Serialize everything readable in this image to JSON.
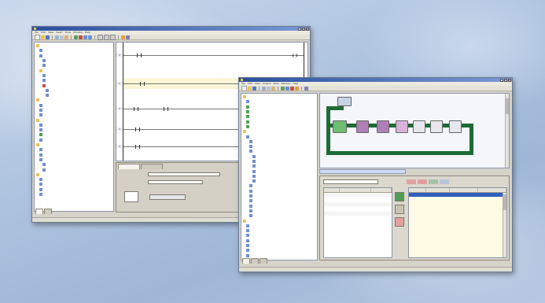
{
  "windows": {
    "back": {
      "title": "",
      "controls": [
        "_",
        "□",
        "×"
      ],
      "menu": [
        "File",
        "Edit",
        "View",
        "Insert",
        "Tools",
        "Window",
        "Help"
      ],
      "tree_items": [
        "",
        "",
        "",
        "",
        "",
        "",
        "",
        "",
        "",
        "",
        "",
        "",
        "",
        "",
        "",
        "",
        "",
        "",
        "",
        "",
        "",
        "",
        "",
        "",
        "",
        "",
        "",
        "",
        "",
        "",
        ""
      ],
      "tabs": [
        "",
        ""
      ],
      "rung_numbers": [
        "0",
        "1",
        "2",
        "3",
        "4"
      ],
      "status": ""
    },
    "front": {
      "title": "",
      "controls": [
        "_",
        "□",
        "×"
      ],
      "menu": [
        "File",
        "Edit",
        "View",
        "Project",
        "Tools",
        "Window",
        "Help"
      ],
      "tree_items": [
        "",
        "",
        "",
        "",
        "",
        "",
        "",
        "",
        "",
        "",
        "",
        "",
        "",
        "",
        "",
        "",
        "",
        "",
        "",
        "",
        "",
        "",
        "",
        "",
        "",
        "",
        "",
        "",
        "",
        "",
        "",
        "",
        ""
      ],
      "tabs": [
        "",
        "",
        ""
      ],
      "drives": [
        "",
        "",
        "",
        "",
        "",
        "",
        "",
        ""
      ],
      "grid_left_headers": [
        "",
        "",
        ""
      ],
      "grid_right_headers": [
        "",
        "",
        "",
        ""
      ],
      "status": ""
    }
  },
  "colors": {
    "network_line": "#1e6b35",
    "selection": "#2f5fbf",
    "title_start": "#2a4f9e",
    "title_end": "#7a98d6"
  }
}
